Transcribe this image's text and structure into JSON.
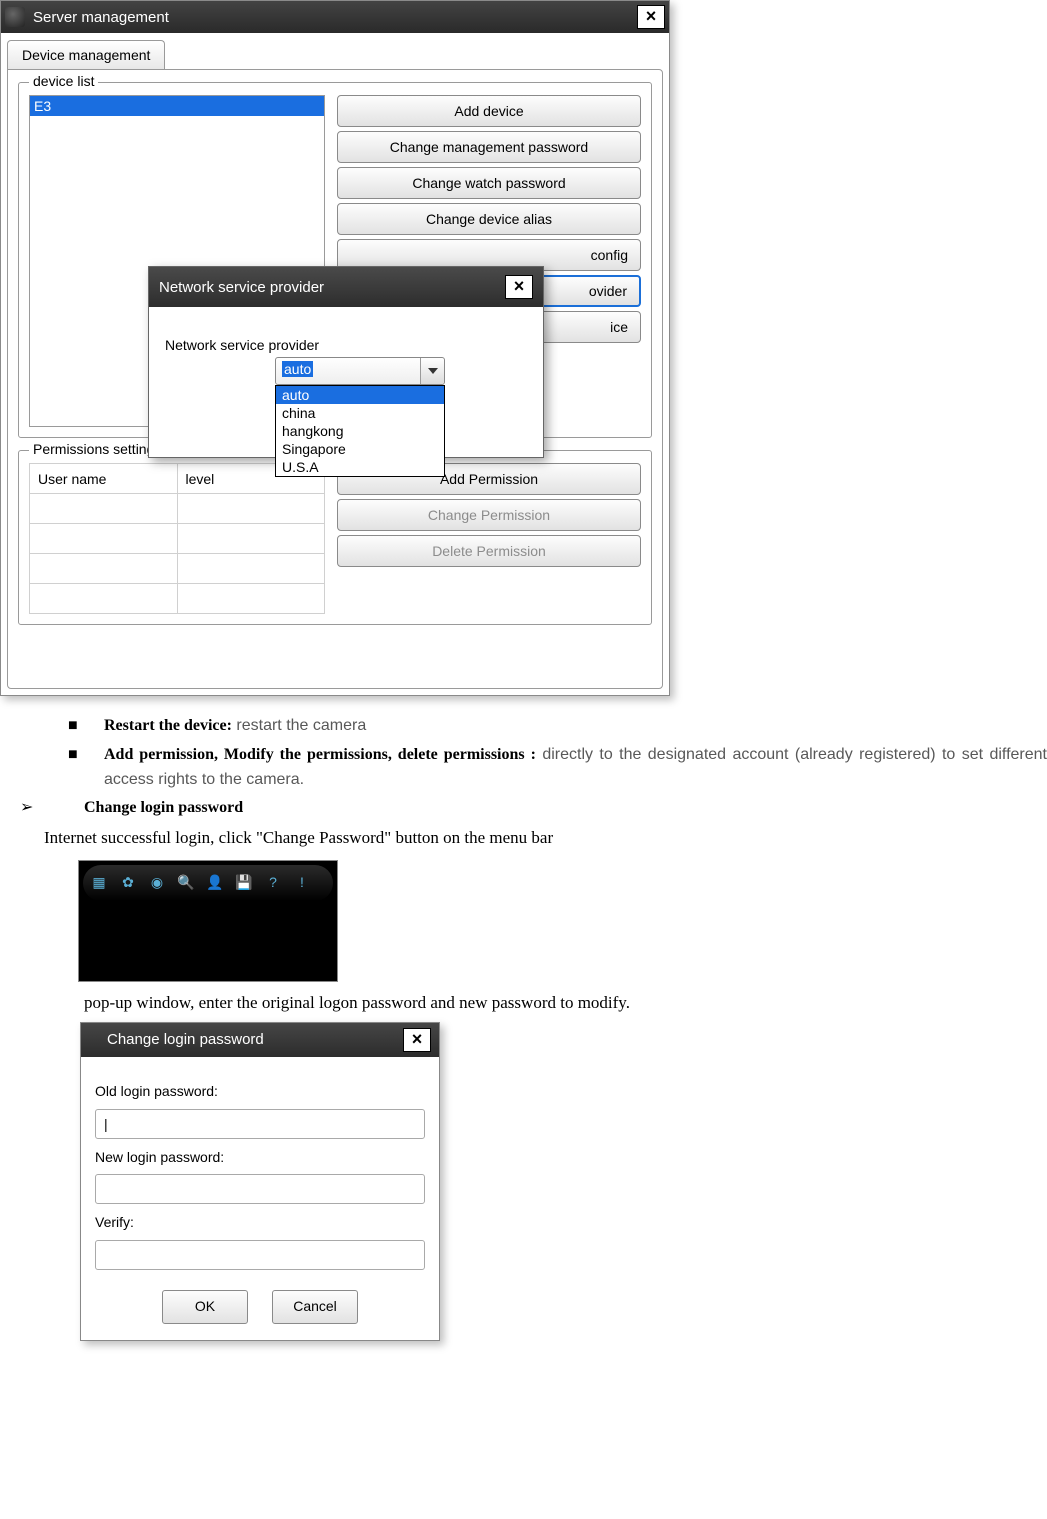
{
  "server_mgmt": {
    "title": "Server management",
    "tab": "Device management",
    "device_list": {
      "legend": "device list",
      "selected_item": "E3"
    },
    "buttons": {
      "add_device": "Add device",
      "change_mgmt_pw": "Change management password",
      "change_watch_pw": "Change watch password",
      "change_alias": "Change device alias",
      "config_partial": "config",
      "provider_partial": "ovider",
      "ice_partial": "ice"
    },
    "permissions": {
      "legend": "Permissions setting",
      "col_user": "User name",
      "col_level": "level",
      "buttons": {
        "add": "Add Permission",
        "change": "Change Permission",
        "delete": "Delete Permission"
      }
    }
  },
  "nsp_dialog": {
    "title": "Network service provider",
    "label": "Network service provider",
    "selected": "auto",
    "options": [
      "auto",
      "china",
      "hangkong",
      "Singapore",
      "U.S.A"
    ]
  },
  "doc": {
    "restart_b": "Restart the device:",
    "restart_t": " restart the camera",
    "perm_b": "Add permission, Modify the permissions, delete permissions :",
    "perm_t": " directly to the designated account (already registered) to set different access rights to the camera.",
    "chg_login": "Change login password",
    "chg_login_desc": "Internet successful login, click \"Change Password\" button on the menu bar",
    "popup_desc": "pop-up window, enter the original logon password and new password to modify."
  },
  "toolbar_icons": [
    "grid-icon",
    "gear-icon",
    "camera-icon",
    "search-icon",
    "user-icon",
    "save-icon",
    "help-icon",
    "info-icon"
  ],
  "clp_dialog": {
    "title": "Change login password",
    "old": "Old login password:",
    "new": "New login password:",
    "verify": "Verify:",
    "ok": "OK",
    "cancel": "Cancel",
    "old_value": "|"
  }
}
